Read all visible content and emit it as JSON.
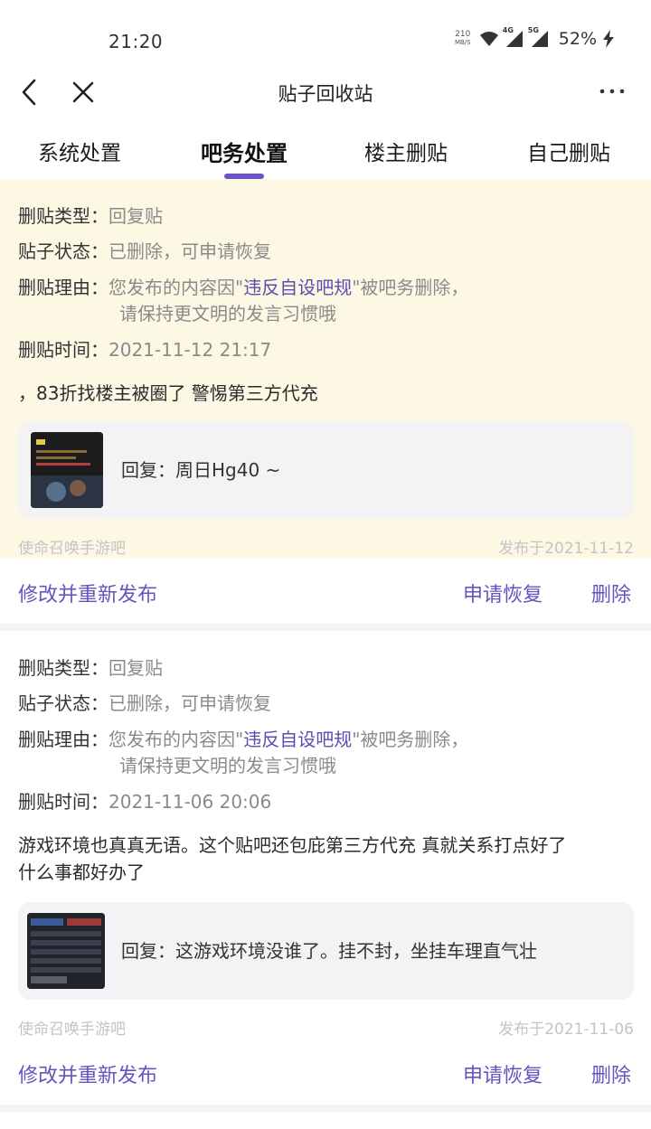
{
  "status_bar": {
    "time": "21:20",
    "net_speed_value": "210",
    "net_speed_unit": "MB/S",
    "sig1_label": "4G",
    "sig2_label": "5G",
    "battery": "52%"
  },
  "nav": {
    "title": "贴子回收站",
    "more": "···"
  },
  "tabs": [
    {
      "label": "系统处置"
    },
    {
      "label": "吧务处置"
    },
    {
      "label": "楼主删贴"
    },
    {
      "label": "自己删贴"
    }
  ],
  "active_tab": "吧务处置",
  "labels": {
    "type_key": "删贴类型：",
    "status_key": "贴子状态：",
    "reason_key": "删贴理由：",
    "time_key": "删贴时间："
  },
  "posts": [
    {
      "type": "回复贴",
      "status": "已删除，可申请恢复",
      "reason_prefix": "您发布的内容因\"",
      "reason_rule": "违反自设吧规",
      "reason_suffix": "\"被吧务删除，",
      "reason_line2": "请保持更文明的发言习惯哦",
      "time": "2021-11-12 21:17",
      "content": "，83折找楼主被圈了 警惕第三方代充",
      "quote": "回复：周日Hg40 ~",
      "forum": "使命召唤手游吧",
      "published": "发布于2021-11-12",
      "action_edit": "修改并重新发布",
      "action_restore": "申请恢复",
      "action_delete": "删除"
    },
    {
      "type": "回复贴",
      "status": "已删除，可申请恢复",
      "reason_prefix": "您发布的内容因\"",
      "reason_rule": "违反自设吧规",
      "reason_suffix": "\"被吧务删除，",
      "reason_line2": "请保持更文明的发言习惯哦",
      "time": "2021-11-06 20:06",
      "content_line1": "游戏环境也真真无语。这个贴吧还包庇第三方代充 真就关系打点好了",
      "content_line2": "什么事都好办了",
      "quote": "回复：这游戏环境没谁了。挂不封，坐挂车理直气壮",
      "forum": "使命召唤手游吧",
      "published": "发布于2021-11-06",
      "action_edit": "修改并重新发布",
      "action_restore": "申请恢复",
      "action_delete": "删除"
    }
  ],
  "colors": {
    "accent": "#6553c0",
    "highlight_bg": "#fdf8e4",
    "quote_bg": "#f3f3f6",
    "muted_text": "#8a8a8a"
  },
  "icons": [
    "back-icon",
    "close-icon",
    "more-icon",
    "wifi-icon",
    "signal-icon",
    "charging-icon"
  ]
}
